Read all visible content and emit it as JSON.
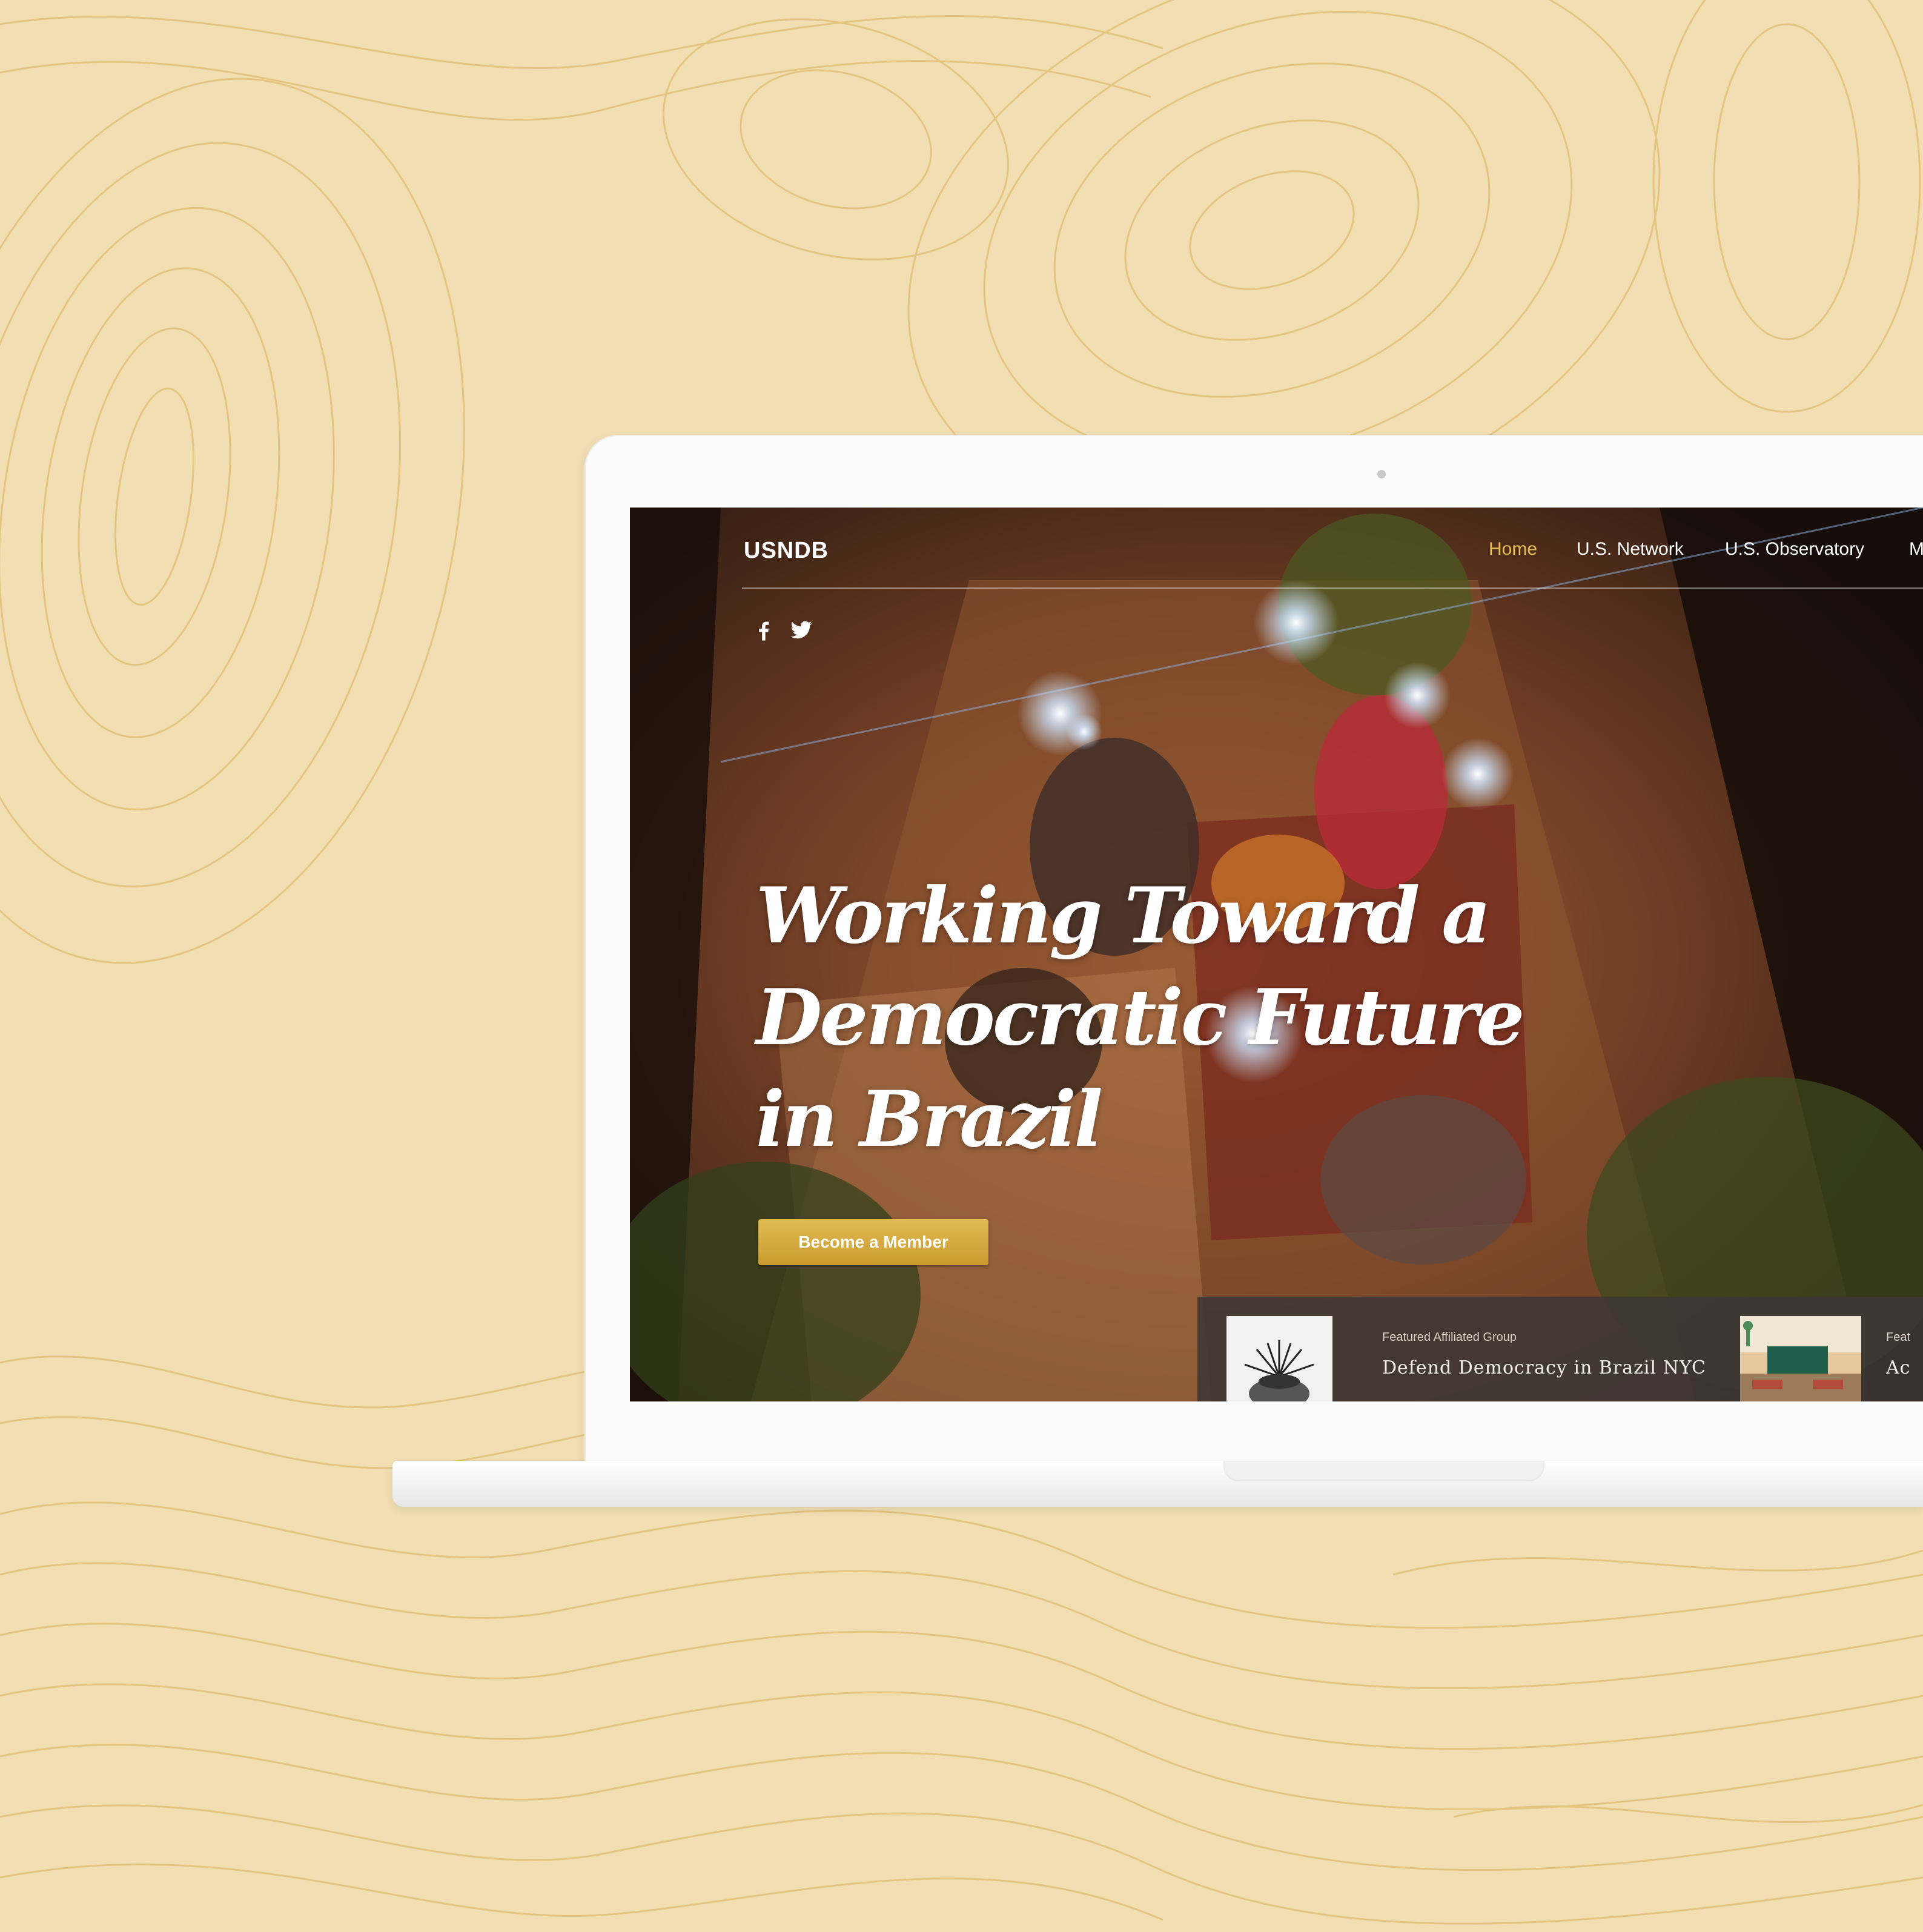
{
  "site": {
    "logo": "USNDB",
    "nav": [
      {
        "label": "Home",
        "active": true
      },
      {
        "label": "U.S. Network"
      },
      {
        "label": "U.S. Observatory"
      },
      {
        "label": "M"
      }
    ],
    "social": [
      {
        "icon": "facebook-icon"
      },
      {
        "icon": "twitter-icon"
      }
    ]
  },
  "hero": {
    "title_lines": [
      "Working Toward a",
      "Democratic Future",
      "in Brazil"
    ],
    "cta_label": "Become a Member"
  },
  "featured": [
    {
      "eyebrow": "Featured Affiliated Group",
      "title": "Defend Democracy in Brazil NYC"
    },
    {
      "eyebrow": "Feat",
      "title": "Ac"
    }
  ],
  "colors": {
    "background": "#f1deb3",
    "topo_line": "#e2c178",
    "accent_gold": "#e6bd52",
    "button_gold": "#d2a843"
  }
}
